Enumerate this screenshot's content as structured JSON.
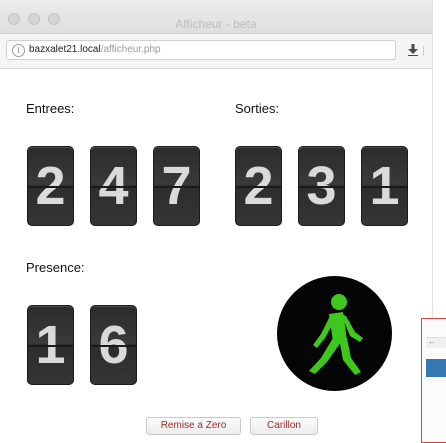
{
  "window": {
    "title": "Afficheur - beta"
  },
  "address_bar": {
    "url_host": "bazxalet21.local",
    "url_path": "/afficheur.php"
  },
  "counters": {
    "entrees": {
      "label": "Entrees:",
      "digits": [
        "2",
        "4",
        "7"
      ]
    },
    "sorties": {
      "label": "Sorties:",
      "digits": [
        "2",
        "3",
        "1"
      ]
    },
    "presence": {
      "label": "Presence:",
      "digits": [
        "1",
        "6"
      ]
    }
  },
  "signal": {
    "state": "walk",
    "icon": "pedestrian-walk-icon",
    "figure_color": "#3ec81d",
    "background_color": "#050505"
  },
  "buttons": {
    "reset_label": "Remise a Zero",
    "chime_label": "Carillon"
  }
}
